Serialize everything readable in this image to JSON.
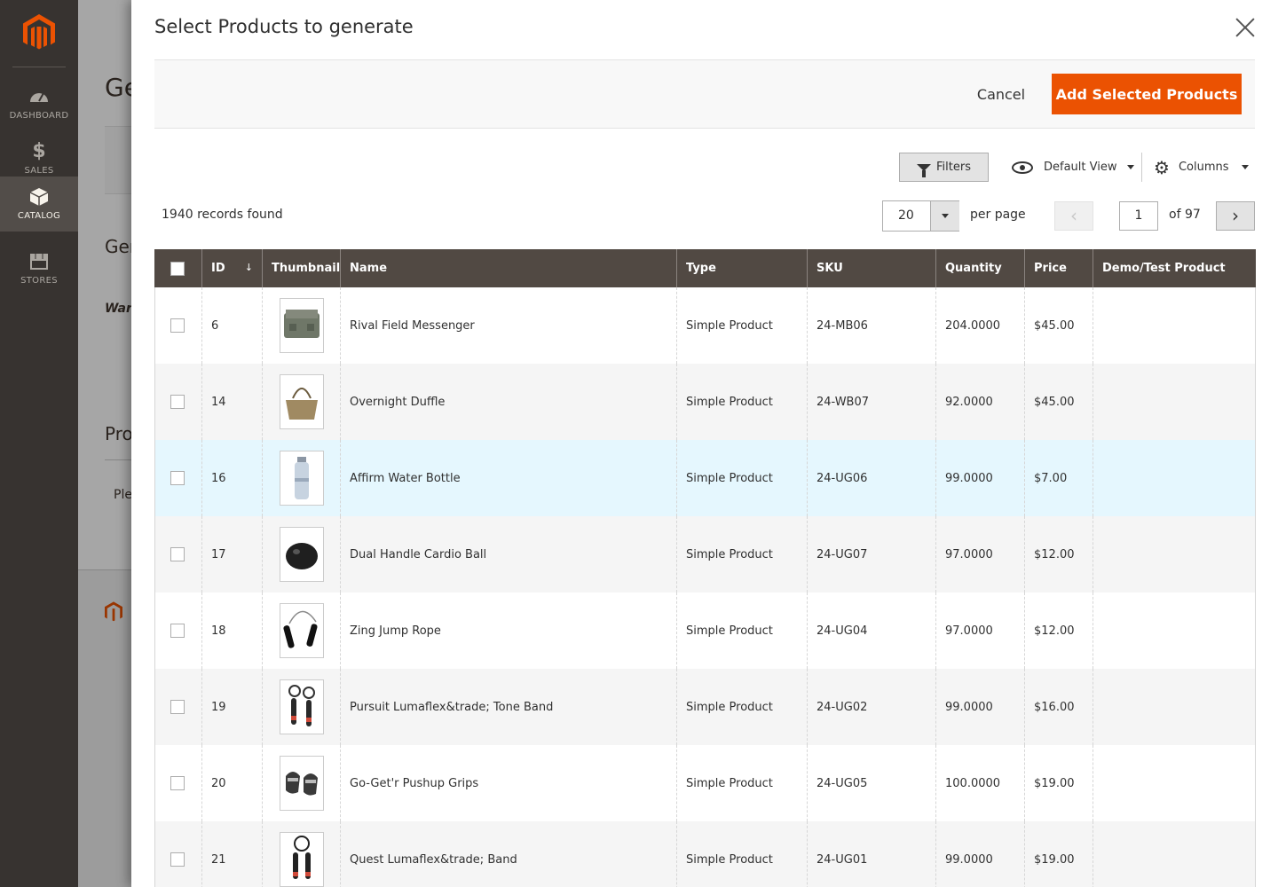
{
  "sidebar": {
    "items": [
      {
        "label": "DASHBOARD",
        "icon": "gauge-icon"
      },
      {
        "label": "SALES",
        "icon": "dollar-icon"
      },
      {
        "label": "CATALOG",
        "icon": "box-icon"
      },
      {
        "label": "STORES",
        "icon": "store-icon"
      }
    ]
  },
  "background": {
    "title_fragment": "Ge",
    "section1": "Gen",
    "warn": "War",
    "section2": "Pro",
    "text": "Ple"
  },
  "modal": {
    "title": "Select Products to generate",
    "cancel_label": "Cancel",
    "add_label": "Add Selected Products"
  },
  "toolbar": {
    "filters_label": "Filters",
    "view_label": "Default View",
    "columns_label": "Columns",
    "records": "1940 records found",
    "per_page_value": "20",
    "per_page_label": "per page",
    "page_value": "1",
    "page_of": "of 97"
  },
  "grid": {
    "columns": [
      "ID",
      "Thumbnail",
      "Name",
      "Type",
      "SKU",
      "Quantity",
      "Price",
      "Demo/Test Product"
    ],
    "rows": [
      {
        "id": "6",
        "name": "Rival Field Messenger",
        "type": "Simple Product",
        "sku": "24-MB06",
        "qty": "204.0000",
        "price": "$45.00",
        "demo": ""
      },
      {
        "id": "14",
        "name": "Overnight Duffle",
        "type": "Simple Product",
        "sku": "24-WB07",
        "qty": "92.0000",
        "price": "$45.00",
        "demo": ""
      },
      {
        "id": "16",
        "name": "Affirm Water Bottle",
        "type": "Simple Product",
        "sku": "24-UG06",
        "qty": "99.0000",
        "price": "$7.00",
        "demo": ""
      },
      {
        "id": "17",
        "name": "Dual Handle Cardio Ball",
        "type": "Simple Product",
        "sku": "24-UG07",
        "qty": "97.0000",
        "price": "$12.00",
        "demo": ""
      },
      {
        "id": "18",
        "name": "Zing Jump Rope",
        "type": "Simple Product",
        "sku": "24-UG04",
        "qty": "97.0000",
        "price": "$12.00",
        "demo": ""
      },
      {
        "id": "19",
        "name": "Pursuit Lumaflex&trade; Tone Band",
        "type": "Simple Product",
        "sku": "24-UG02",
        "qty": "99.0000",
        "price": "$16.00",
        "demo": ""
      },
      {
        "id": "20",
        "name": "Go-Get'r Pushup Grips",
        "type": "Simple Product",
        "sku": "24-UG05",
        "qty": "100.0000",
        "price": "$19.00",
        "demo": ""
      },
      {
        "id": "21",
        "name": "Quest Lumaflex&trade; Band",
        "type": "Simple Product",
        "sku": "24-UG01",
        "qty": "99.0000",
        "price": "$19.00",
        "demo": ""
      }
    ]
  },
  "colors": {
    "accent": "#eb5202",
    "header_bg": "#514943",
    "sidebar_bg": "#373330",
    "highlight_row": "#e5f7fe"
  }
}
